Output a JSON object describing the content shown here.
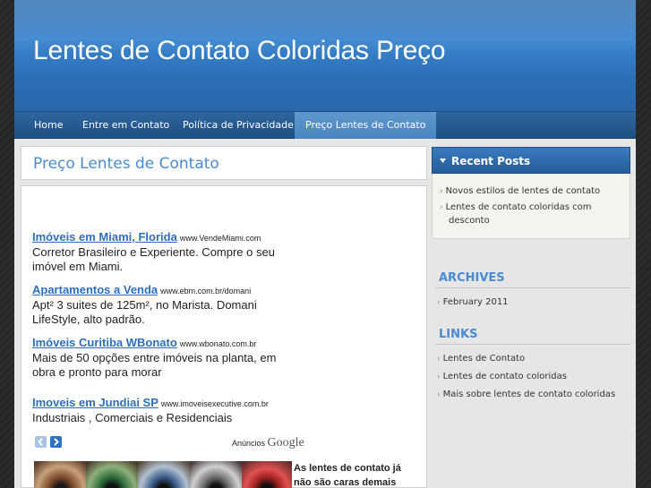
{
  "header": {
    "site_title": "Lentes de Contato Coloridas Preço"
  },
  "nav": {
    "items": [
      {
        "label": "Home"
      },
      {
        "label": "Entre em Contato"
      },
      {
        "label": "Política de Privacidade"
      },
      {
        "label": "Preço Lentes de Contato"
      }
    ],
    "active_index": 3
  },
  "main": {
    "page_title": "Preço Lentes de Contato",
    "ads": [
      {
        "title": "Imóveis em Miami, Florida",
        "url": "www.VendeMiami.com",
        "desc": "Corretor Brasileiro e Experiente. Compre o seu imóvel em Miami."
      },
      {
        "title": "Apartamentos a Venda",
        "url": "www.ebm.com.br/domani",
        "desc": "Apt² 3 suites de 125m², no Marista. Domani LifeStyle, alto padrão."
      },
      {
        "title": "Imóveis Curitiba WBonato",
        "url": "www.wbonato.com.br",
        "desc": "Mais de 50 opções entre imóveis na planta, em obra e pronto para morar"
      },
      {
        "title": "Imoveis em Jundiai SP",
        "url": "www.imoveisexecutive.com.br",
        "desc": "Industriais , Comerciais e Residenciais"
      }
    ],
    "ads_by_label": "Anúncios",
    "ads_by_brand": "Google",
    "teaser": "As lentes de contato já não são caras demais"
  },
  "sidebar": {
    "recent_posts_heading": "Recent Posts",
    "recent_posts": [
      {
        "label": "Novos estilos de lentes de contato"
      },
      {
        "label": "Lentes de contato coloridas com"
      },
      {
        "label": "desconto"
      }
    ],
    "archives_heading": "ARCHIVES",
    "archives": [
      {
        "label": "February 2011"
      }
    ],
    "links_heading": "LINKS",
    "links": [
      {
        "label": "Lentes de Contato"
      },
      {
        "label": "Lentes de contato coloridas"
      },
      {
        "label": "Mais sobre lentes de contato coloridas"
      }
    ]
  },
  "icons": {
    "prev": "chevron-left-icon",
    "next": "chevron-right-icon",
    "bullet": "bullet-arrow-icon",
    "dropdown": "triangle-down-icon"
  },
  "colors": {
    "header_blue": "#3b86cf",
    "nav_blue": "#2f66a0",
    "link_blue": "#2b6fc2",
    "heading_blue": "#4a8bd0"
  }
}
